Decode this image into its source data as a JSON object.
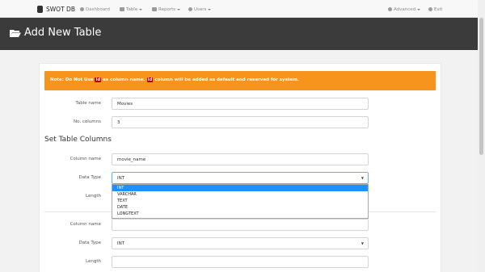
{
  "navbar": {
    "brand": "SWOT DB",
    "items": [
      {
        "label": "Dashboard",
        "icon": "dashboard-icon"
      },
      {
        "label": "Table",
        "icon": "table-icon"
      },
      {
        "label": "Reports",
        "icon": "reports-icon"
      },
      {
        "label": "Users",
        "icon": "user-icon"
      }
    ],
    "right_items": [
      {
        "label": "Advanced",
        "icon": "gear-icon"
      },
      {
        "label": "Exit",
        "icon": "power-icon"
      }
    ]
  },
  "page": {
    "title": "Add New Table",
    "icon": "folder-open-icon"
  },
  "alert": {
    "prefix": "Note: Do Not Use ",
    "keyword1": "id",
    "middle": " as column name. ",
    "keyword2": "id",
    "suffix": " column will be added as default and reserved for system.",
    "color": "#f7941d"
  },
  "form": {
    "table_name_label": "Table name",
    "table_name_value": "Movies",
    "no_columns_label": "No. columns",
    "no_columns_value": "3",
    "section_title": "Set Table Columns",
    "column1": {
      "name_label": "Column name",
      "name_value": "movie_name",
      "type_label": "Data Type",
      "type_value": "INT",
      "length_label": "Length"
    },
    "column2": {
      "name_label": "Column name",
      "name_value": "",
      "type_label": "Data Type",
      "type_value": "INT",
      "length_label": "Length",
      "length_value": ""
    }
  },
  "dropdown": {
    "options": [
      "INT",
      "VARCHAR",
      "TEXT",
      "DATE",
      "LONGTEXT"
    ],
    "selected": "INT",
    "highlight_color": "#1e90ff"
  }
}
